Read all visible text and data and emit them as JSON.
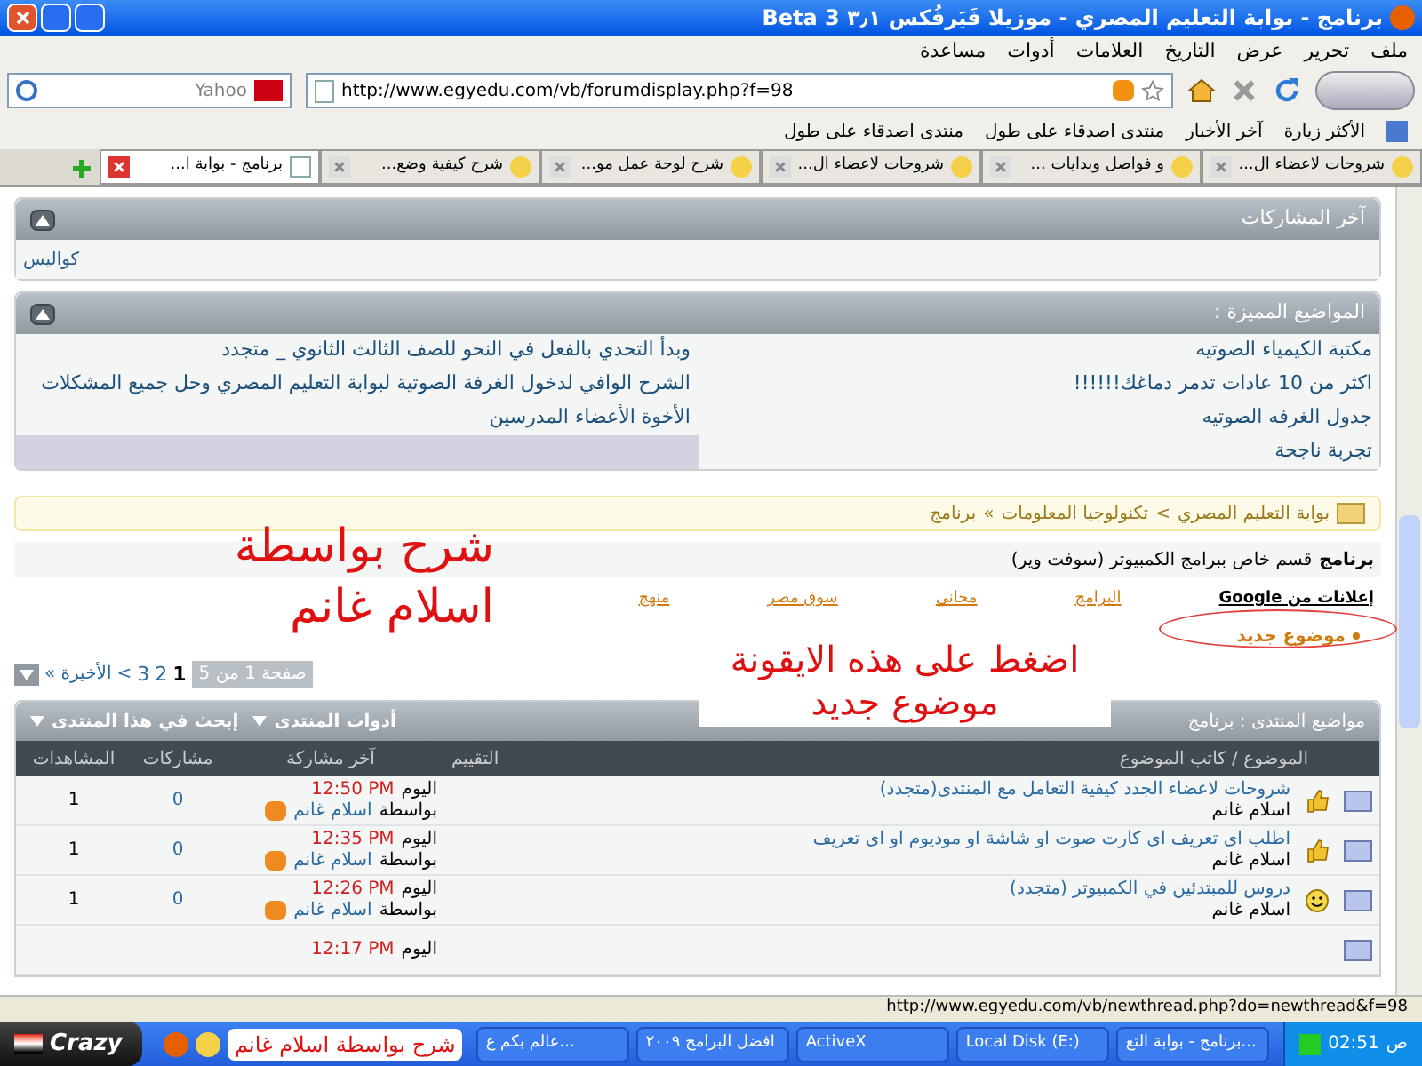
{
  "window": {
    "title": "برنامج - بوابة التعليم المصري - موزيلا فَيَرفُكس ٣٫١ Beta 3"
  },
  "menu": [
    "ملف",
    "تحرير",
    "عرض",
    "التاريخ",
    "العلامات",
    "أدوات",
    "مساعدة"
  ],
  "nav": {
    "url": "http://www.egyedu.com/vb/forumdisplay.php?f=98",
    "search_placeholder": "Yahoo"
  },
  "bookmarks": [
    "الأكثر زيارة",
    "آخر الأخبار",
    "منتدى اصدقاء على طول",
    "منتدى اصدقاء على طول"
  ],
  "tabs": [
    {
      "label": "شروحات لاعضاء ال...",
      "selected": false
    },
    {
      "label": "و فواصل وبدايات ...",
      "selected": false
    },
    {
      "label": "شروحات لاعضاء ال...",
      "selected": false
    },
    {
      "label": "شرح لوحة عمل مو...",
      "selected": false
    },
    {
      "label": "شرح كيفية وضع...",
      "selected": false
    },
    {
      "label": "برنامج - بوابة ا...",
      "selected": true
    }
  ],
  "latest_posts": {
    "title": "آخر المشاركات",
    "items": [
      "كواليس"
    ]
  },
  "featured": {
    "title": "المواضيع المميزة :",
    "right": [
      "مكتبة الكيمياء الصوتيه",
      "اكثر من 10 عادات تدمر دماغك!!!!!!",
      "جدول الغرفه الصوتيه",
      "تجربة ناجحة"
    ],
    "left": [
      "وبدأ التحدي بالفعل في النحو للصف الثالث الثانوي _ متجدد",
      "الشرح الوافي لدخول الغرفة الصوتية لبوابة التعليم المصري وحل جميع المشكلات",
      "الأخوة الأعضاء المدرسين"
    ]
  },
  "breadcrumb": {
    "items": [
      "بوابة التعليم المصري",
      "تكنولوجيا المعلومات",
      "برنامج"
    ],
    "separators": [
      ">",
      "»"
    ]
  },
  "forum": {
    "name": "برنامج",
    "description": "قسم خاص ببرامج الكمبيوتر (سوفت وير)"
  },
  "ads": {
    "label": "إعلانات من Google",
    "links": [
      "البرامج",
      "مجاني",
      "سوق مصر",
      "منهج"
    ]
  },
  "new_thread": "موضوع جديد",
  "pagination": {
    "label": "صفحة 1 من 5",
    "pages": [
      {
        "label": "1",
        "selected": true
      },
      {
        "label": "2",
        "selected": false
      },
      {
        "label": "3",
        "selected": false
      }
    ],
    "next": ">",
    "last": "الأخيرة »"
  },
  "threads": {
    "title": "مواضيع المنتدى : برنامج",
    "tools": [
      "أدوات المنتدى",
      "إبحث في هذا المنتدى"
    ],
    "columns": [
      "الموضوع / كاتب الموضوع",
      "التقييم",
      "آخر مشاركة",
      "مشاركات",
      "المشاهدات"
    ],
    "rows": [
      {
        "kind": "thumb",
        "title": "شروحات لاعضاء الجدد كيفية التعامل مع المنتدى(متجدد)",
        "author": "اسلام غانم",
        "day": "اليوم",
        "time": "12:50 PM",
        "by": "بواسطة",
        "last_poster": "اسلام غانم",
        "replies": "0",
        "views": "1"
      },
      {
        "kind": "thumb",
        "title": "اطلب اى تعريف اى كارت صوت او شاشة او موديوم او اى تعريف",
        "author": "اسلام غانم",
        "day": "اليوم",
        "time": "12:35 PM",
        "by": "بواسطة",
        "last_poster": "اسلام غانم",
        "replies": "0",
        "views": "1"
      },
      {
        "kind": "smile",
        "title": "دروس للمبتدئين في الكمبيوتر (متجدد)",
        "author": "اسلام غانم",
        "day": "اليوم",
        "time": "12:26 PM",
        "by": "بواسطة",
        "last_poster": "اسلام غانم",
        "replies": "0",
        "views": "1"
      },
      {
        "kind": "none",
        "day": "اليوم",
        "time": "12:17 PM"
      }
    ]
  },
  "status": {
    "url": "http://www.egyedu.com/vb/newthread.php?do=newthread&f=98"
  },
  "taskbar": {
    "start": "Crazy",
    "items": [
      "برنامج - بوابة التع...",
      "Local Disk (E:)",
      "ActiveX",
      "افضل البرامج ٢٠٠٩",
      "عالم بكم ع..."
    ],
    "clock": "02:51",
    "ampm": "ص"
  },
  "annotations": {
    "credit": "شرح بواسطة اسلام غانم",
    "hint": "اضغط على هذه الايقونة",
    "hint_target": "موضوع جديد",
    "footer_credit": "شرح بواسطة اسلام غانم"
  }
}
